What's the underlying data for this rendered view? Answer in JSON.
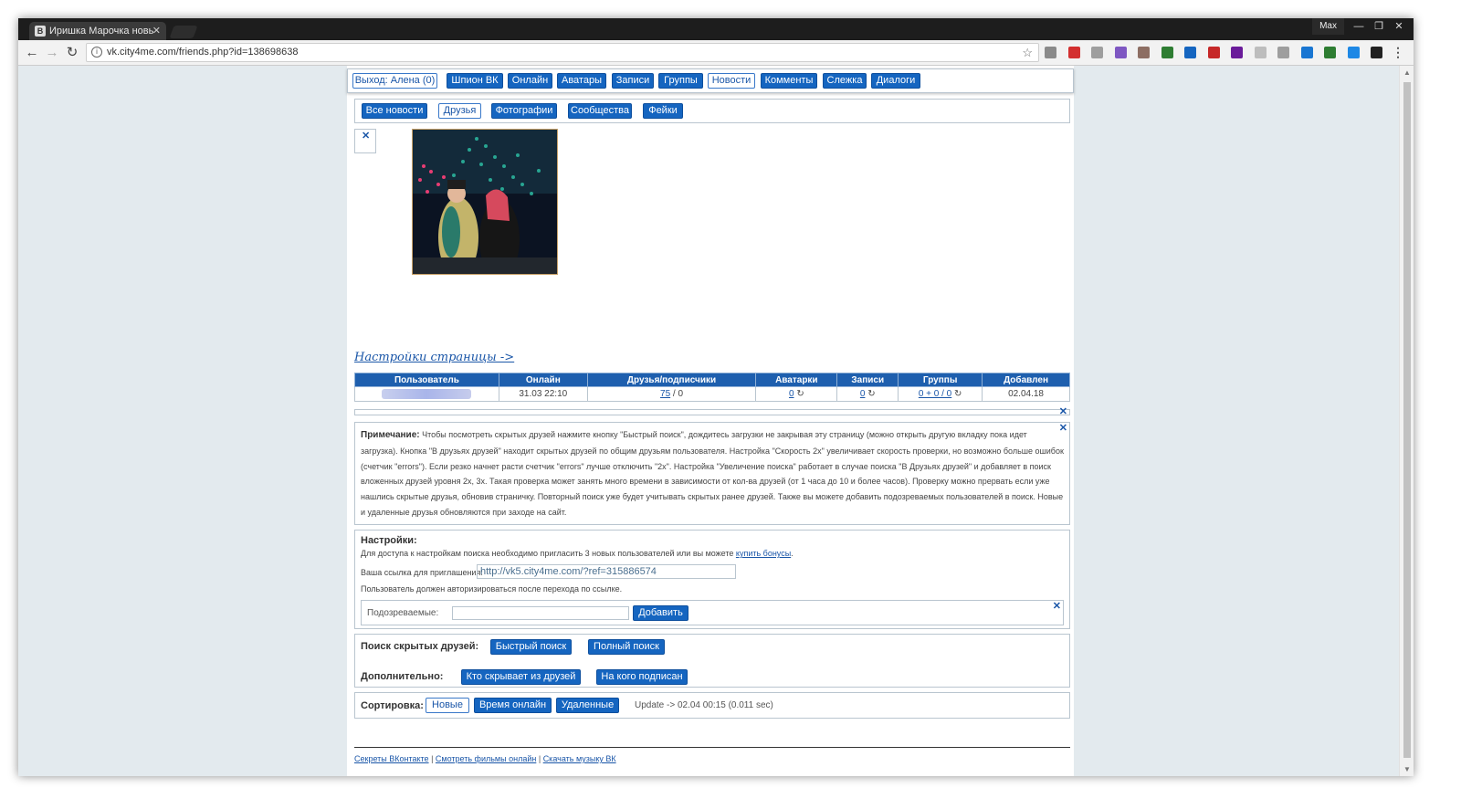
{
  "browser": {
    "tab_title": "Иришка Марочка новь",
    "tab_favicon": "B",
    "profile": "Max",
    "url": "vk.city4me.com/friends.php?id=138698638",
    "ext_colors": [
      "#8a8a8a",
      "#d32f2f",
      "#9e9e9e",
      "#7e57c2",
      "#8d6e63",
      "#2e7d32",
      "#1565c0",
      "#c62828",
      "#6a1b9a",
      "#bdbdbd",
      "#9e9e9e",
      "#1976d2",
      "#2e7d32",
      "#1e88e5",
      "#212121"
    ]
  },
  "topnav": {
    "logout": "Выход: Алена (0)",
    "items": [
      "Шпион ВК",
      "Онлайн",
      "Аватары",
      "Записи",
      "Группы",
      "Новости",
      "Комменты",
      "Слежка",
      "Диалоги"
    ]
  },
  "subnav": {
    "items": [
      "Все новости",
      "Друзья",
      "Фотографии",
      "Сообщества",
      "Фейки"
    ]
  },
  "settings_link": "Настройки страницы ->",
  "stats": {
    "headers": [
      "Пользователь",
      "Онлайн",
      "Друзья/подписчики",
      "Аватарки",
      "Записи",
      "Группы",
      "Добавлен"
    ],
    "online": "31.03 22:10",
    "friends": "75",
    "subscribers": " / 0",
    "avatars": "0",
    "records": "0",
    "groups": "0 + 0 / 0",
    "added": "02.04.18"
  },
  "note": {
    "label": "Примечание:",
    "text": "Чтобы посмотреть скрытых друзей нажмите кнопку \"Быстрый поиск\", дождитесь загрузки не закрывая эту страницу (можно открыть другую вкладку пока идет загрузка). Кнопка \"В друзьях друзей\" находит скрытых друзей по общим друзьям пользователя. Настройка \"Скорость 2x\" увеличивает скорость проверки, но возможно больше ошибок (счетчик \"errors\"). Если резко начнет расти счетчик \"errors\" лучше отключить \"2x\". Настройка \"Увеличение поиска\" работает в случае поиска \"В Друзьях друзей\" и добавляет в поиск вложенных друзей уровня 2x, 3x. Такая проверка может занять много времени в зависимости от кол-ва друзей (от 1 часа до 10 и более часов). Проверку можно прервать если уже нашлись скрытые друзья, обновив страничку. Повторный поиск уже будет учитывать скрытых ранее друзей. Также вы можете добавить подозреваемых пользователей в поиск. Новые и удаленные друзья обновляются при заходе на сайт."
  },
  "settings": {
    "title": "Настройки:",
    "access_text": "Для доступа к настройкам поиска необходимо пригласить 3 новых пользователей или вы можете ",
    "buy_link": "купить бонусы",
    "invite_label": "Ваша ссылка для приглашения:",
    "invite_url": "http://vk5.city4me.com/?ref=315886574",
    "auth_note": "Пользователь должен авторизироваться после перехода по ссылке.",
    "suspects_label": "Подозреваемые:",
    "add_button": "Добавить"
  },
  "search": {
    "hidden_label": "Поиск скрытых друзей:",
    "quick": "Быстрый поиск",
    "full": "Полный поиск",
    "extra_label": "Дополнительно:",
    "who_hides": "Кто скрывает из друзей",
    "subscribed": "На кого подписан"
  },
  "sort": {
    "label": "Сортировка:",
    "new": "Новые",
    "online_time": "Время онлайн",
    "deleted": "Удаленные",
    "update": "Update -> 02.04 00:15 (0.011 sec)"
  },
  "footer": {
    "links": [
      "Секреты ВКонтакте",
      "Смотреть фильмы онлайн",
      "Скачать музыку ВК"
    ]
  }
}
